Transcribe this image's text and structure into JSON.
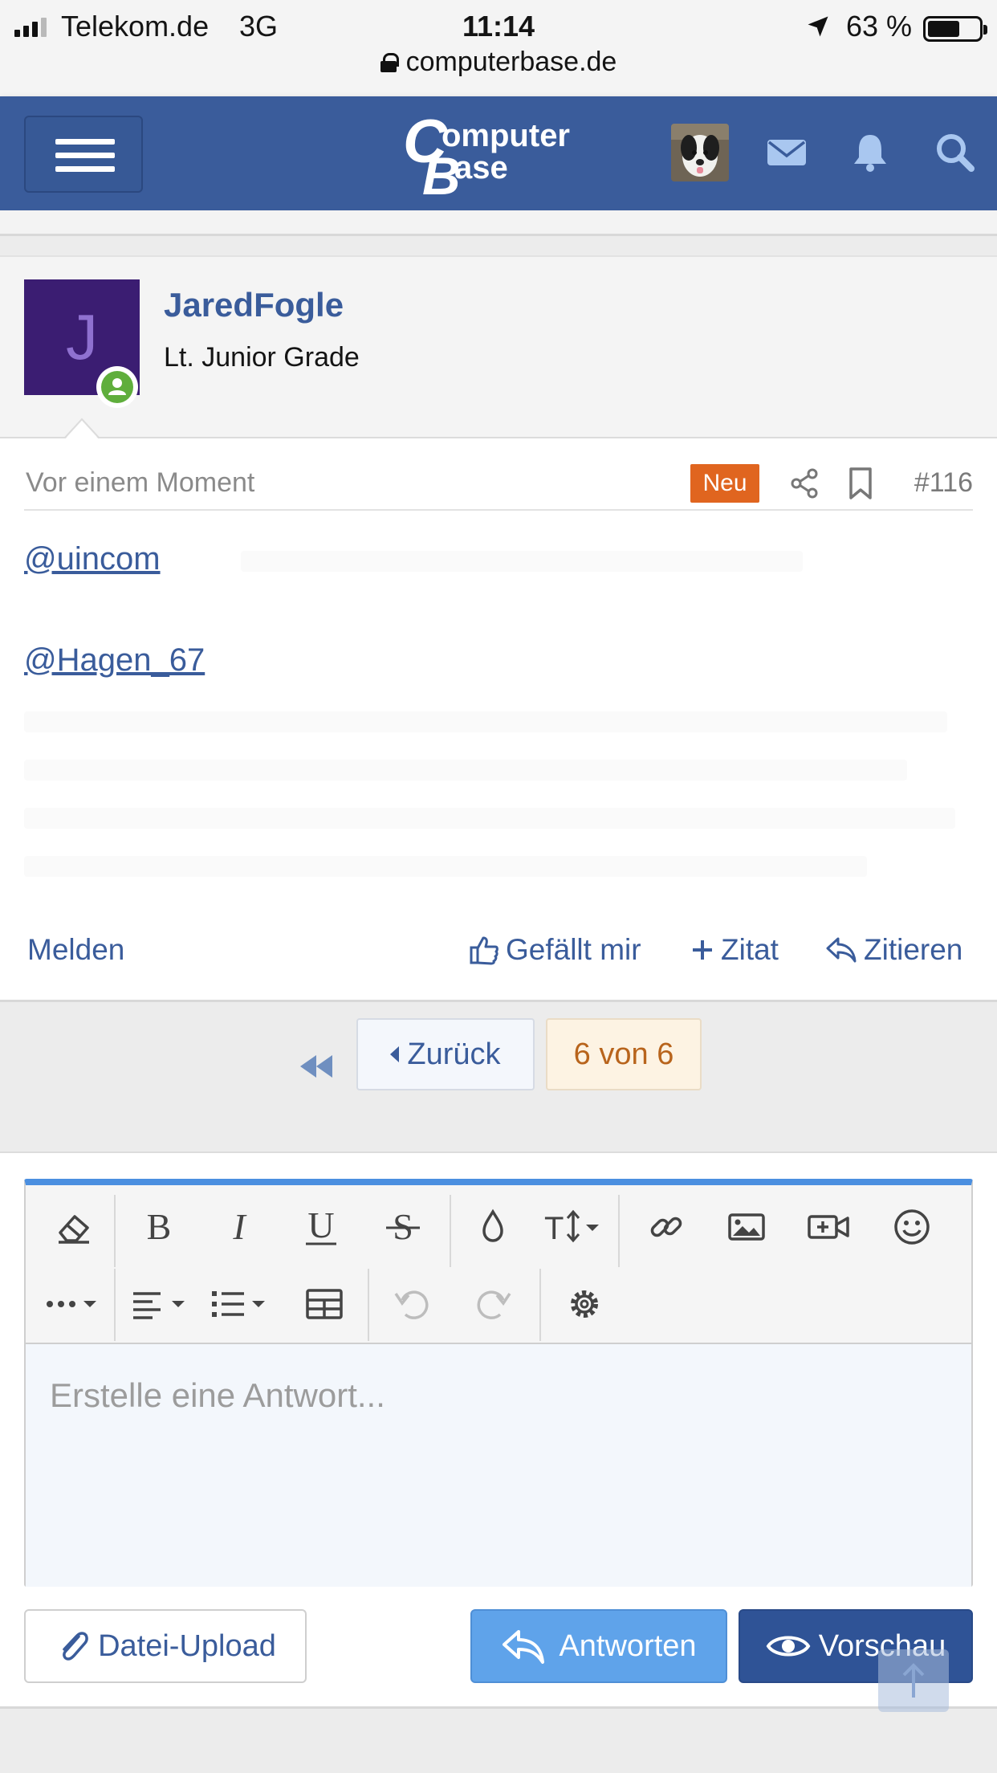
{
  "status_bar": {
    "carrier": "Telekom.de",
    "network": "3G",
    "time": "11:14",
    "battery": "63 %",
    "battery_level": 0.63,
    "url": "computerbase.de"
  },
  "header": {
    "logo_text_1": "omputer",
    "logo_text_2": "ase",
    "logo_letter_c": "C",
    "logo_letter_b": "B",
    "icons": [
      "menu-icon",
      "avatar",
      "envelope-icon",
      "bell-icon",
      "search-icon"
    ],
    "brand_color": "#3a5c9b"
  },
  "post": {
    "author": "JaredFogle",
    "avatar_letter": "J",
    "rank": "Lt. Junior Grade",
    "time": "Vor einem Moment",
    "new_badge": "Neu",
    "number": "#116",
    "mention_1": "@uincom",
    "mention_2": "@Hagen_67",
    "actions": {
      "report": "Melden",
      "like": "Gefällt mir",
      "add_quote": "Zitat",
      "quote": "Zitieren"
    }
  },
  "pagination": {
    "prev": "Zurück",
    "current": "6 von 6"
  },
  "editor": {
    "placeholder": "Erstelle eine Antwort...",
    "toolbar_row_1": [
      "eraser-icon",
      "bold-icon",
      "italic-icon",
      "underline-icon",
      "strikethrough-icon",
      "color-drop-icon",
      "font-size-icon",
      "link-icon",
      "image-icon",
      "video-icon",
      "smiley-icon"
    ],
    "toolbar_row_2": [
      "more-icon",
      "align-icon",
      "list-icon",
      "table-icon",
      "undo-icon",
      "redo-icon",
      "settings-icon"
    ],
    "accent_color": "#4b8fe0"
  },
  "buttons": {
    "upload": "Datei-Upload",
    "reply": "Antworten",
    "preview": "Vorschau"
  }
}
